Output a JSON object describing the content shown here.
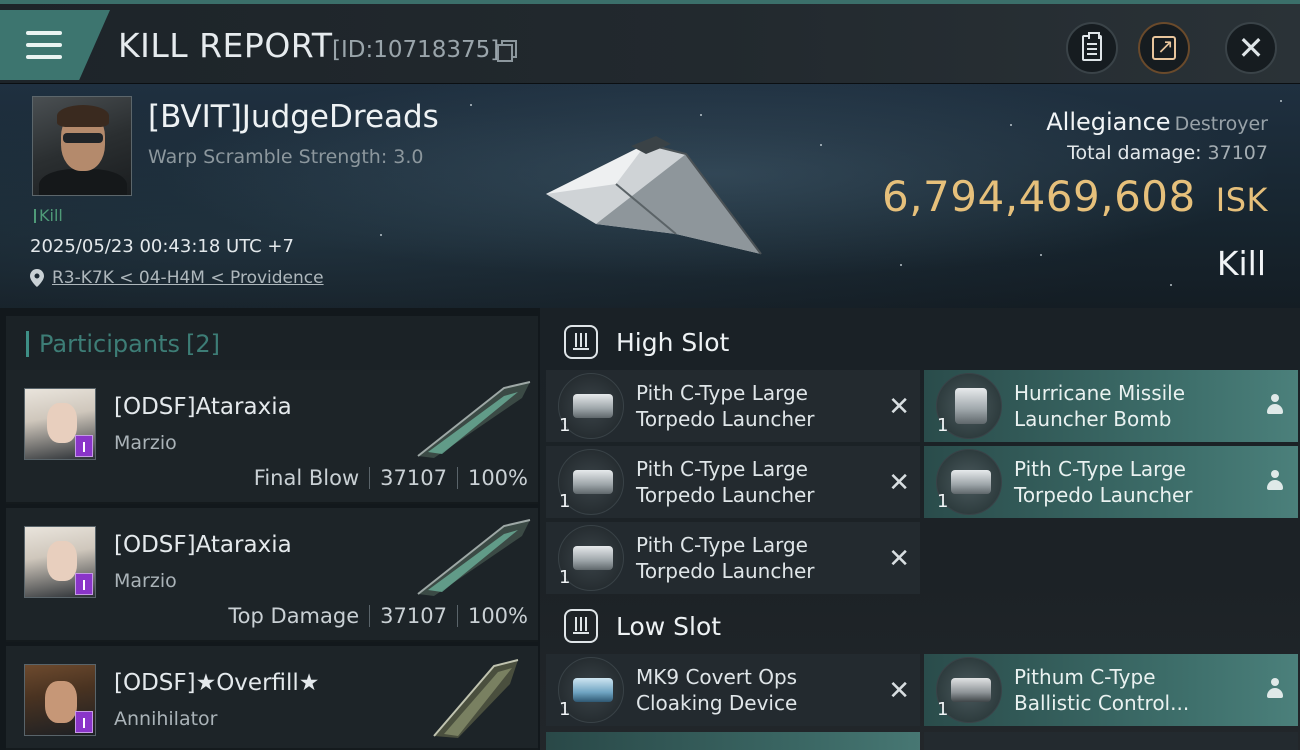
{
  "header": {
    "title": "KILL REPORT",
    "report_id": "[ID:10718375]",
    "icons": [
      "menu-icon",
      "copy-icon",
      "clipboard-icon",
      "share-icon",
      "close-icon"
    ]
  },
  "victim": {
    "name": "[BVIT]JudgeDreads",
    "warp_scramble": "Warp Scramble Strength: 3.0",
    "kill_tag": "Kill",
    "datetime": "2025/05/23 00:43:18 UTC +7",
    "location": "R3-K7K < 04-H4M < Providence",
    "ship": "Allegiance",
    "ship_class": "Destroyer",
    "total_damage_label": "Total damage:",
    "total_damage": "37107",
    "isk_value": "6,794,469,608",
    "isk_unit": "ISK",
    "result": "Kill"
  },
  "participants": {
    "label": "Participants",
    "count": "[2]",
    "items": [
      {
        "name": "[ODSF]Ataraxia",
        "ship": "Marzio",
        "role": "Final Blow",
        "damage": "37107",
        "percent": "100%"
      },
      {
        "name": "[ODSF]Ataraxia",
        "ship": "Marzio",
        "role": "Top Damage",
        "damage": "37107",
        "percent": "100%"
      },
      {
        "name": "[ODSF]★Overfill★",
        "ship": "Annihilator"
      }
    ]
  },
  "fittings": {
    "high_slot_label": "High Slot",
    "low_slot_label": "Low Slot",
    "high": [
      {
        "name_line1": "Pith C-Type Large",
        "name_line2": "Torpedo Launcher",
        "qty": "1",
        "status": "destroyed"
      },
      {
        "name_line1": "Hurricane Missile",
        "name_line2": "Launcher Bomb",
        "qty": "1",
        "status": "dropped"
      },
      {
        "name_line1": "Pith C-Type Large",
        "name_line2": "Torpedo Launcher",
        "qty": "1",
        "status": "destroyed"
      },
      {
        "name_line1": "Pith C-Type Large",
        "name_line2": "Torpedo Launcher",
        "qty": "1",
        "status": "dropped"
      },
      {
        "name_line1": "Pith C-Type Large",
        "name_line2": "Torpedo Launcher",
        "qty": "1",
        "status": "destroyed"
      }
    ],
    "low": [
      {
        "name_line1": "MK9 Covert Ops",
        "name_line2": "Cloaking Device",
        "qty": "1",
        "status": "destroyed"
      },
      {
        "name_line1": "Pithum C-Type",
        "name_line2": "Ballistic Control...",
        "qty": "1",
        "status": "dropped"
      }
    ]
  },
  "colors": {
    "accent_teal": "#3d756f",
    "isk_gold": "#e6c07b",
    "kill_green": "#4f9a78",
    "badge_purple": "#8a35c9"
  }
}
